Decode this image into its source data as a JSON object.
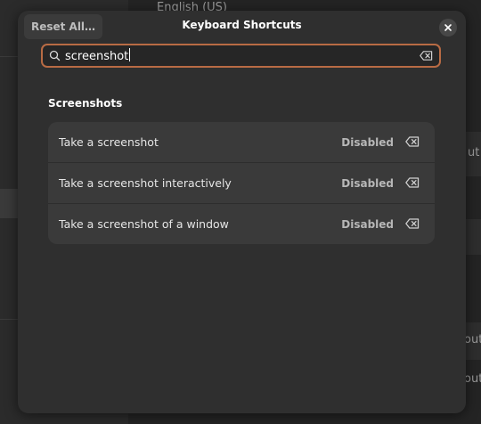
{
  "background": {
    "partial_texts": [
      "English (US)",
      "ut",
      "out"
    ]
  },
  "dialog": {
    "title": "Keyboard Shortcuts",
    "reset_label": "Reset All…"
  },
  "search": {
    "value": "screenshot"
  },
  "section": {
    "title": "Screenshots"
  },
  "shortcuts": [
    {
      "label": "Take a screenshot",
      "status": "Disabled"
    },
    {
      "label": "Take a screenshot interactively",
      "status": "Disabled"
    },
    {
      "label": "Take a screenshot of a window",
      "status": "Disabled"
    }
  ],
  "colors": {
    "accent_focus": "#b86b44",
    "dialog_bg": "#2f2f2f",
    "row_bg": "#3a3a3a"
  }
}
